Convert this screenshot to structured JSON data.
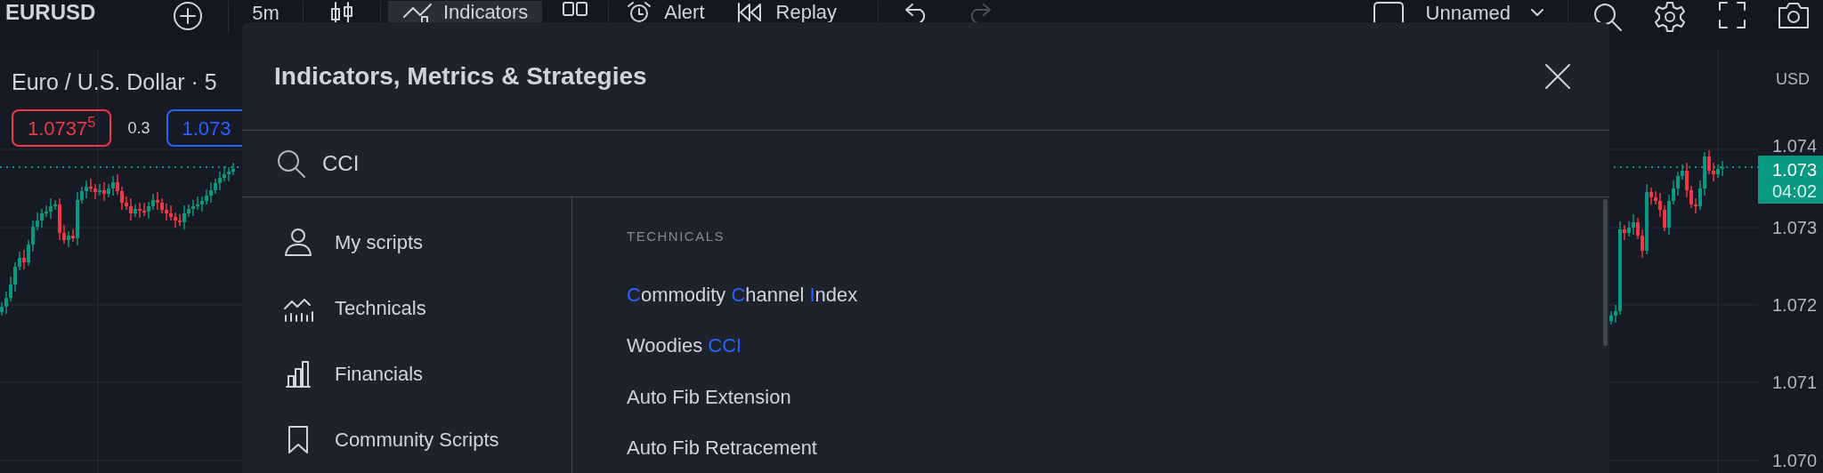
{
  "toolbar": {
    "symbol": "EURUSD",
    "interval": "5m",
    "indicators_button": {
      "label": "Indicators",
      "selected": true
    },
    "alert": "Alert",
    "replay": "Replay",
    "undo": {
      "disabled": false
    },
    "redo": {
      "disabled": true
    },
    "layout_name": "Unnamed"
  },
  "chart": {
    "title": "Euro / U.S. Dollar · 5",
    "bid": "1.0737$^{5}$",
    "spread": "0.3",
    "ask": "1.073",
    "currency": "USD",
    "price_labels": [
      "1.074",
      "1.073",
      "1.072",
      "1.071",
      "1.070"
    ],
    "last_price": {
      "price": "1.073",
      "countdown": "04:02"
    }
  },
  "dialog": {
    "title": "Indicators, Metrics & Strategies",
    "search": {
      "value": "CCI"
    },
    "sidebar": [
      {
        "label": "My scripts",
        "selected": false
      },
      {
        "label": "Technicals",
        "selected": false
      },
      {
        "label": "Financials",
        "selected": false
      },
      {
        "label": "Community Scripts",
        "selected": false
      }
    ],
    "section": "TECHNICALS",
    "results": [
      {
        "segments": [
          {
            "text": "C",
            "match": true
          },
          {
            "text": "ommodity ",
            "match": false
          },
          {
            "text": "C",
            "match": true
          },
          {
            "text": "hannel ",
            "match": false
          },
          {
            "text": "I",
            "match": true
          },
          {
            "text": "ndex",
            "match": false
          }
        ]
      },
      {
        "segments": [
          {
            "text": "Woodies ",
            "match": false
          },
          {
            "text": "CCI",
            "match": true
          }
        ]
      },
      {
        "segments": [
          {
            "text": "Auto Fib Extension",
            "match": false
          }
        ]
      },
      {
        "segments": [
          {
            "text": "Auto Fib Retracement",
            "match": false
          }
        ]
      }
    ]
  }
}
